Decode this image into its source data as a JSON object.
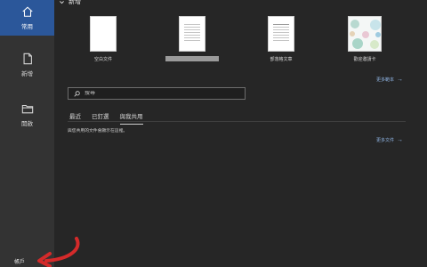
{
  "rail": {
    "home_label": "常用",
    "new_label": "新增",
    "open_label": "開啟",
    "bottom_label": "帳戶"
  },
  "section": {
    "title": "新增"
  },
  "templates": [
    {
      "label": "空白文件"
    },
    {
      "label": ""
    },
    {
      "label": "部落格文章"
    },
    {
      "label": "歡迎邀請卡"
    }
  ],
  "links": {
    "more_templates": "更多範本",
    "more_documents": "更多文件"
  },
  "search": {
    "placeholder": "搜尋",
    "value": ""
  },
  "tabs": [
    {
      "label": "最近"
    },
    {
      "label": "已釘選"
    },
    {
      "label": "與我共用"
    }
  ],
  "active_tab": "與我共用",
  "empty_message": "與您共用的文件會顯示在這裡。",
  "colors": {
    "accent": "#2b579a",
    "link": "#8fb4e3",
    "annotation": "#d42a2a"
  }
}
